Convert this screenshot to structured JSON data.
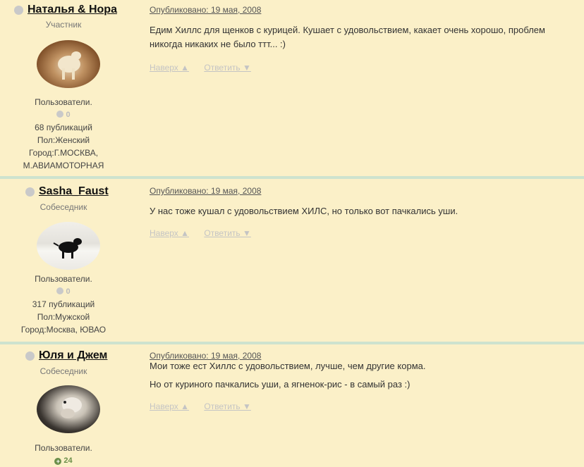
{
  "posts": [
    {
      "username": "Наталья & Нора",
      "role": "Участник",
      "group": "Пользователи.",
      "reputation": "0",
      "publications": "68 публикаций",
      "details": [
        "Пол:Женский",
        "Город:Г.МОСКВА,",
        "М.АВИАМОТОРНАЯ"
      ],
      "meta": "Опубликовано: 19 мая, 2008",
      "text": [
        "Едим Хиллс для щенков с курицей. Кушает с удовольствием, какает очень хорошо, проблем никогда никаких не было ттт... :)"
      ],
      "actions": {
        "top": "Наверх ▲",
        "reply": "Ответить ▼"
      }
    },
    {
      "username": "Sasha_Faust",
      "role": "Собеседник",
      "group": "Пользователи.",
      "reputation": "0",
      "publications": "317 публикаций",
      "details": [
        "Пол:Мужской",
        "Город:Москва, ЮВАО"
      ],
      "meta": "Опубликовано: 19 мая, 2008",
      "text": [
        "У нас тоже кушал с удовольствием ХИЛС, но только вот пачкались уши."
      ],
      "actions": {
        "top": "Наверх ▲",
        "reply": "Ответить ▼"
      }
    },
    {
      "username": "Юля и Джем",
      "role": "Собеседник",
      "group": "Пользователи.",
      "reputation": "24",
      "publications": "",
      "details": [],
      "meta": "Опубликовано: 19 мая, 2008",
      "text": [
        "Мои тоже ест Хиллс с удовольствием, лучше, чем другие корма.",
        "Но от куриного пачкались уши, а ягненок-рис - в самый раз :)"
      ],
      "actions": {
        "top": "Наверх ▲",
        "reply": "Ответить ▼"
      }
    }
  ]
}
